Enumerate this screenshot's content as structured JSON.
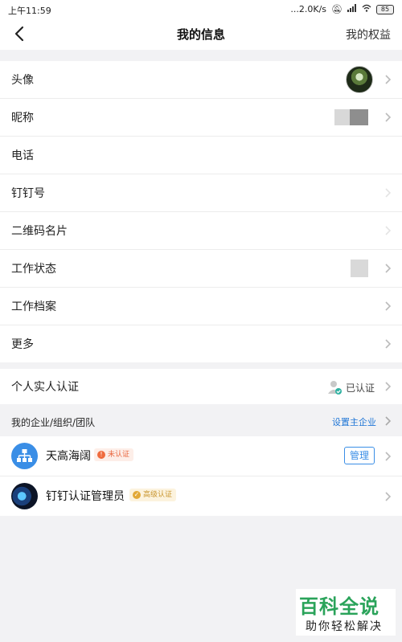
{
  "status_bar": {
    "time": "上午11:59",
    "net_speed": "...2.0K/s",
    "battery": "85"
  },
  "nav": {
    "title": "我的信息",
    "right_link": "我的权益"
  },
  "profile": {
    "rows": [
      {
        "label": "头像"
      },
      {
        "label": "昵称"
      },
      {
        "label": "电话"
      },
      {
        "label": "钉钉号"
      },
      {
        "label": "二维码名片"
      },
      {
        "label": "工作状态"
      },
      {
        "label": "工作档案"
      },
      {
        "label": "更多"
      }
    ]
  },
  "identity": {
    "label": "个人实人认证",
    "status": "已认证"
  },
  "orgs": {
    "header": "我的企业/组织/团队",
    "set_main": "设置主企业",
    "items": [
      {
        "name": "天高海阔",
        "tag": "未认证",
        "action": "管理"
      },
      {
        "name": "钉钉认证管理员",
        "tag": "高级认证"
      }
    ]
  },
  "watermark": {
    "title": "百科全说",
    "subtitle": "助你轻松解决"
  },
  "colors": {
    "accent": "#3a8ee6",
    "link_blue": "#1f76d6",
    "unverified": "#ef6b3d",
    "advanced": "#e2a937",
    "watermark_green": "#2aa35a"
  }
}
